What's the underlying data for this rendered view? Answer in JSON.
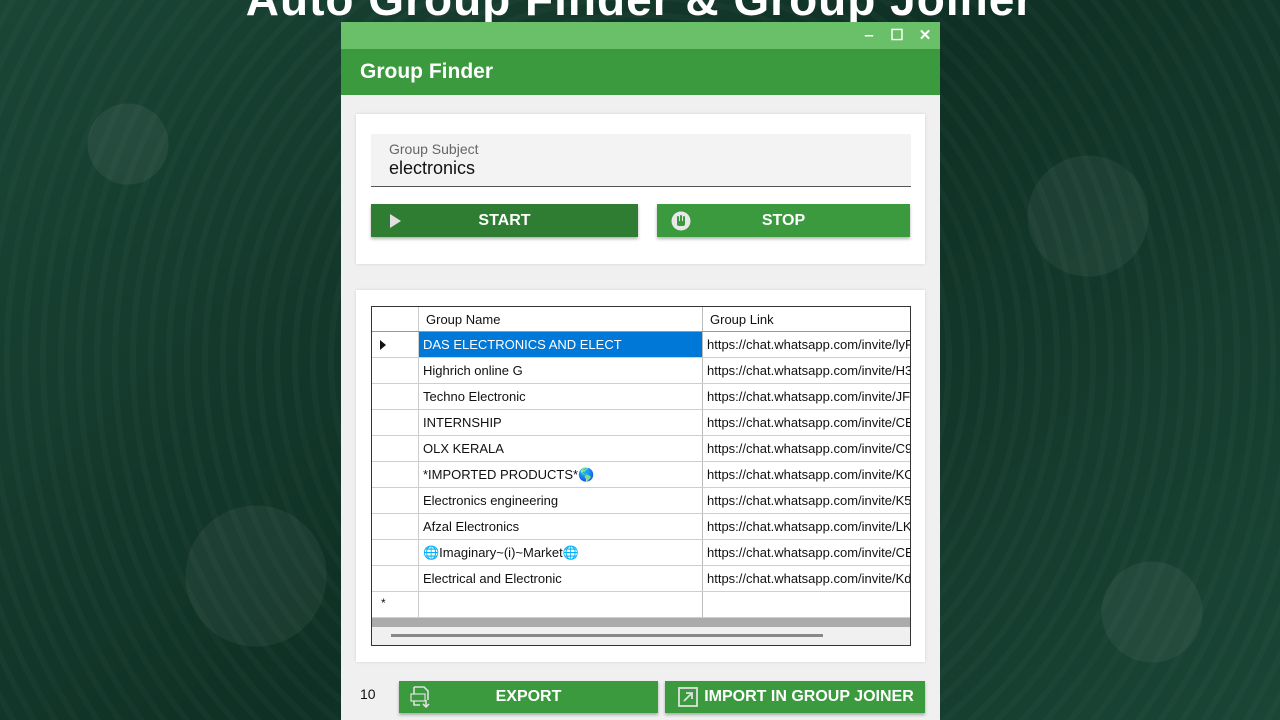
{
  "background": {
    "heading": "Auto Group Finder & Group Joiner"
  },
  "window": {
    "controls": {
      "minimize": "‒",
      "maximize": "☐",
      "close": "✕"
    },
    "title": "Group Finder"
  },
  "search": {
    "label": "Group Subject",
    "value": "electronics"
  },
  "buttons": {
    "start": "START",
    "stop": "STOP",
    "export": "EXPORT",
    "import": "IMPORT IN GROUP JOINER"
  },
  "grid": {
    "columns": [
      "Group Name",
      "Group Link"
    ],
    "rows": [
      {
        "name": "DAS ELECTRONICS AND ELECT",
        "link": "https://chat.whatsapp.com/invite/lyF"
      },
      {
        "name": "Highrich online G",
        "link": "https://chat.whatsapp.com/invite/H3"
      },
      {
        "name": "Techno Electronic",
        "link": "https://chat.whatsapp.com/invite/JFh"
      },
      {
        "name": "INTERNSHIP",
        "link": "https://chat.whatsapp.com/invite/CBI"
      },
      {
        "name": "OLX KERALA",
        "link": "https://chat.whatsapp.com/invite/C9"
      },
      {
        "name": "*IMPORTED PRODUCTS*🌎",
        "link": "https://chat.whatsapp.com/invite/KO"
      },
      {
        "name": "Electronics engineering",
        "link": "https://chat.whatsapp.com/invite/K5"
      },
      {
        "name": "Afzal Electronics",
        "link": "https://chat.whatsapp.com/invite/LK"
      },
      {
        "name": "🌐Imaginary~(i)~Market🌐",
        "link": "https://chat.whatsapp.com/invite/CE"
      },
      {
        "name": "Electrical and Electronic",
        "link": "https://chat.whatsapp.com/invite/Kd"
      }
    ],
    "new_row_marker": "*"
  },
  "footer": {
    "count": "10"
  },
  "colors": {
    "accent": "#3a9a3d",
    "accent_dark": "#2e7d32",
    "title_bar": "#6abf69",
    "selection": "#0078d7"
  }
}
